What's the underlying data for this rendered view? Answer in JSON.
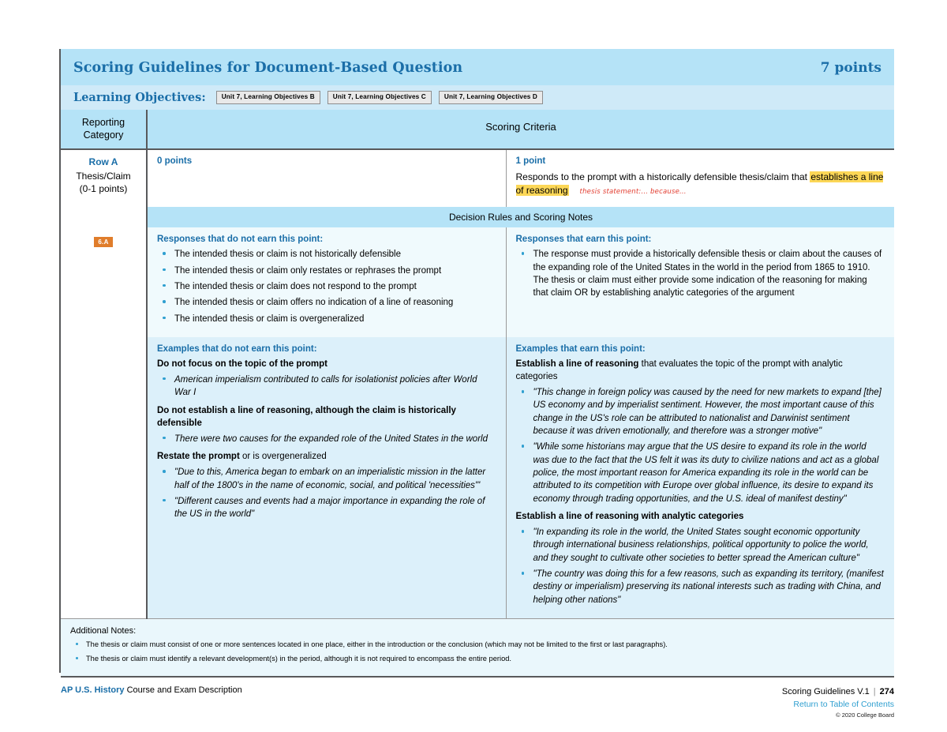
{
  "header": {
    "title": "Scoring Guidelines for Document-Based Question",
    "points": "7 points",
    "learning_objectives_label": "Learning Objectives:",
    "learning_objectives": [
      "Unit 7, Learning Objectives B",
      "Unit 7, Learning Objectives C",
      "Unit 7, Learning Objectives D"
    ],
    "accent_color": "#1a6ea8",
    "band_color": "#b5e3f7"
  },
  "table": {
    "col_headers": {
      "reporting_category": "Reporting Category",
      "scoring_criteria": "Scoring Criteria"
    },
    "category": {
      "row": "Row A",
      "name": "Thesis/Claim",
      "points": "(0-1 points)",
      "skill_badge": "6.A",
      "skill_badge_color": "#e07d2b"
    },
    "zero_points": {
      "label": "0 points",
      "text": ""
    },
    "one_point": {
      "label": "1 point",
      "text_before_highlight": "Responds to the prompt with a historically defensible thesis/claim that ",
      "highlight": "establishes a line of reasoning",
      "highlight_color": "#fcd757",
      "annotation": "thesis statement:... because...",
      "annotation_color": "#e23b2e"
    },
    "decision_bar": "Decision Rules and Scoring Notes",
    "rules_left": {
      "heading": "Responses that do not earn this point:",
      "items": [
        "The intended thesis or claim is not historically defensible",
        "The intended thesis or claim only restates or rephrases the prompt",
        "The intended thesis or claim does not respond to the prompt",
        "The intended thesis or claim offers no indication of a line of reasoning",
        "The intended thesis or claim is overgeneralized"
      ]
    },
    "rules_right": {
      "heading": "Responses that earn this point:",
      "items": [
        "The response must provide a historically defensible thesis or claim about the causes of the expanding role of the United States in the world in the period from 1865 to 1910. The thesis or claim must either provide some indication of the reasoning for making that claim OR by establishing analytic categories of the argument"
      ]
    },
    "examples_left": {
      "heading": "Examples that do not earn this point:",
      "groups": [
        {
          "subhead_bold": "Do not focus on the topic of the prompt",
          "subhead_regular": "",
          "items": [
            "American imperialism contributed to calls for isolationist policies after World War I"
          ]
        },
        {
          "subhead_bold": "Do not establish a line of reasoning, although the claim is historically defensible",
          "subhead_regular": "",
          "items": [
            "There were two causes for the expanded role of the United States in the world"
          ]
        },
        {
          "subhead_bold": "Restate the prompt",
          "subhead_regular": " or is overgeneralized",
          "items": [
            "\"Due to this, America began to embark on an imperialistic mission in the latter half of the 1800's in the name of economic, social, and political 'necessities'\"",
            "\"Different causes and events had a major importance in expanding the role of the US in the world\""
          ]
        }
      ]
    },
    "examples_right": {
      "heading": "Examples that earn this point:",
      "groups": [
        {
          "subhead_bold": "Establish a line of reasoning",
          "subhead_regular": " that evaluates the topic of the prompt with analytic categories",
          "items": [
            "\"This change in foreign policy was caused by the need for new markets to expand [the] US economy and by imperialist sentiment. However, the most important cause of this change in the US's role can be attributed to nationalist and Darwinist sentiment because it was driven emotionally, and therefore was a stronger motive\"",
            "\"While some historians may argue that the US desire to expand its role in the world was due to the fact that the US felt it was its duty to civilize nations and act as a global police, the most important reason for America expanding its role in the world can be attributed to its competition with Europe over global influence, its desire to expand its economy through trading opportunities, and the U.S. ideal of manifest destiny\""
          ]
        },
        {
          "subhead_bold": "Establish a line of reasoning with analytic categories",
          "subhead_regular": "",
          "items": [
            "\"In expanding its role in the world, the United States sought economic opportunity through international business relationships, political opportunity to police the world, and they sought to cultivate other societies to better spread the American culture\"",
            "\"The country was doing this for a few reasons, such as expanding its territory, (manifest destiny or imperialism) preserving its national interests such as trading with China, and helping other nations\""
          ]
        }
      ]
    },
    "additional_notes": {
      "heading": "Additional Notes:",
      "items": [
        "The thesis or claim must consist of one or more sentences located in one place, either in the introduction or the conclusion (which may not be limited to the first or last paragraphs).",
        "The thesis or claim must identify a relevant development(s) in the period, although it is not required to encompass the entire period."
      ]
    }
  },
  "footer": {
    "course_brand": "AP U.S. History",
    "course_text": "Course and Exam Description",
    "doc_label": "Scoring Guidelines  V.1",
    "separator": "|",
    "page_number": "274",
    "return_link": "Return to Table of Contents",
    "copyright": "© 2020 College Board"
  }
}
